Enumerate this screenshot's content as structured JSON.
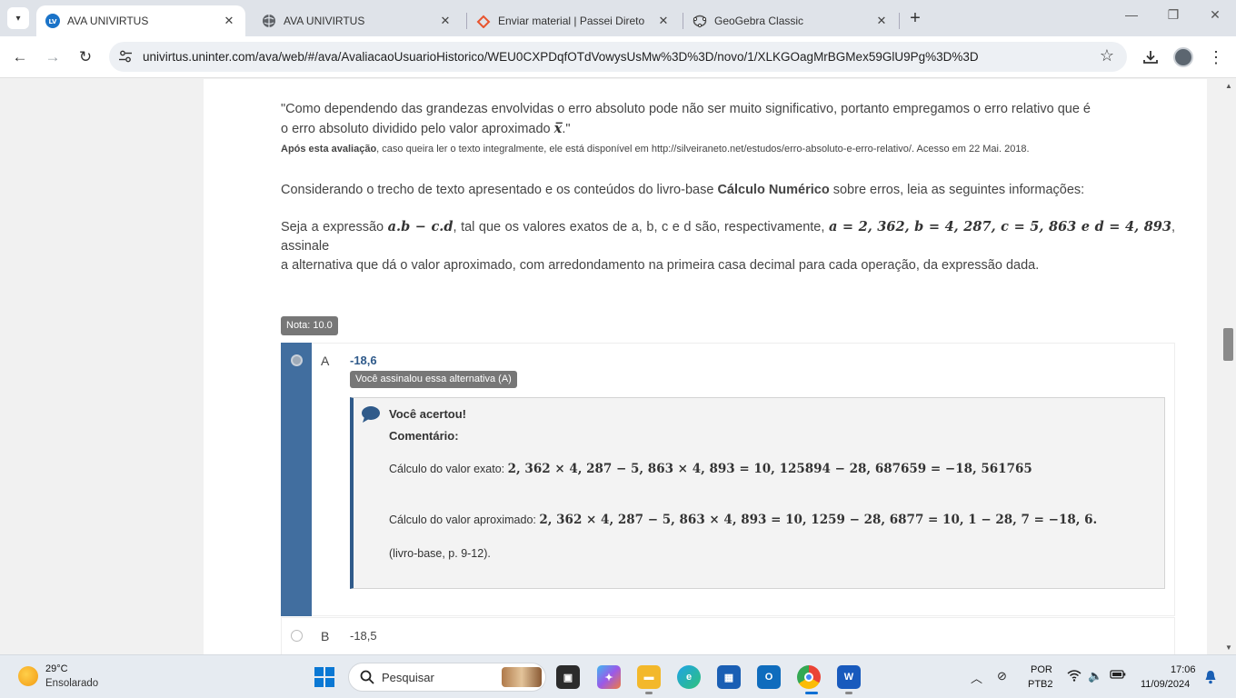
{
  "browser": {
    "tabs": [
      {
        "title": "AVA UNIVIRTUS",
        "active": true,
        "icon": "univirtus-logo-icon"
      },
      {
        "title": "AVA UNIVIRTUS",
        "active": false,
        "icon": "globe-icon"
      },
      {
        "title": "Enviar material | Passei Direto",
        "active": false,
        "icon": "passei-direto-icon"
      },
      {
        "title": "GeoGebra Classic",
        "active": false,
        "icon": "geogebra-icon"
      }
    ],
    "url": "univirtus.uninter.com/ava/web/#/ava/AvaliacaoUsuarioHistorico/WEU0CXPDqfOTdVowysUsMw%3D%3D/novo/1/XLKGOagMrBGMex59GlU9Pg%3D%3D"
  },
  "question": {
    "quote_line1": "\"Como dependendo das grandezas envolvidas o erro absoluto pode não ser muito significativo, portanto empregamos o erro relativo que é",
    "quote_line2_prefix": "o erro absoluto dividido pelo valor aproximado ",
    "quote_xbar": "x̅",
    "quote_line2_suffix": ".\"",
    "source_bold": "Após esta avaliação",
    "source_rest": ", caso queira ler o texto integralmente, ele está disponível em http://silveiraneto.net/estudos/erro-absoluto-e-erro-relativo/. Acesso em 22 Mai. 2018.",
    "consider_prefix": "Considerando o trecho de texto apresentado e os conteúdos do livro-base ",
    "consider_bold": "Cálculo Numérico",
    "consider_suffix": " sobre erros, leia as seguintes informações:",
    "expr_prefix": "Seja a expressão ",
    "expr_math": "a.b − c.d",
    "expr_middle": ", tal que os valores exatos de a, b, c e d são, respectivamente, ",
    "expr_values": "a = 2, 362,  b = 4, 287,  c = 5, 863 e d = 4, 893",
    "expr_suffix": ", assinale",
    "expr_line2": "a alternativa que dá o valor aproximado, com arredondamento na primeira casa decimal para cada operação, da expressão dada."
  },
  "grade": "Nota: 10.0",
  "options": [
    {
      "letter": "A",
      "value": "-18,6",
      "selected": true,
      "badge": "Você assinalou essa alternativa (A)"
    },
    {
      "letter": "B",
      "value": "-18,5",
      "selected": false
    }
  ],
  "feedback": {
    "title": "Você acertou!",
    "comment_label": "Comentário:",
    "exact_label": "Cálculo do valor exato: ",
    "exact_math": "2, 362 × 4, 287 − 5, 863 × 4, 893 = 10, 125894 − 28, 687659 = −18, 561765",
    "approx_label": "Cálculo do valor aproximado: ",
    "approx_math": "2, 362 × 4, 287 − 5, 863 × 4, 893 = 10, 1259 − 28, 6877 = 10, 1 − 28, 7 = −18, 6.",
    "reference": "(livro-base, p. 9-12)."
  },
  "taskbar": {
    "temperature": "29°C",
    "weather": "Ensolarado",
    "search_placeholder": "Pesquisar",
    "lang_line1": "POR",
    "lang_line2": "PTB2",
    "time": "17:06",
    "date": "11/09/2024"
  }
}
